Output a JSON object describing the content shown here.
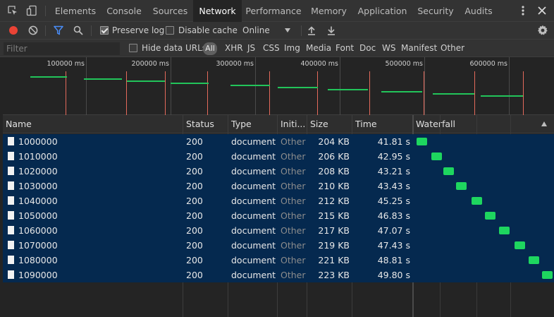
{
  "tabs": [
    {
      "id": "elements",
      "label": "Elements",
      "active": false
    },
    {
      "id": "console",
      "label": "Console",
      "active": false
    },
    {
      "id": "sources",
      "label": "Sources",
      "active": false
    },
    {
      "id": "network",
      "label": "Network",
      "active": true
    },
    {
      "id": "performance",
      "label": "Performance",
      "active": false
    },
    {
      "id": "memory",
      "label": "Memory",
      "active": false
    },
    {
      "id": "application",
      "label": "Application",
      "active": false
    },
    {
      "id": "security",
      "label": "Security",
      "active": false
    },
    {
      "id": "audits",
      "label": "Audits",
      "active": false
    }
  ],
  "toolbar": {
    "preserve_log_label": "Preserve log",
    "preserve_log_checked": true,
    "disable_cache_label": "Disable cache",
    "disable_cache_checked": false,
    "throttling_value": "Online"
  },
  "filterbar": {
    "filter_placeholder": "Filter",
    "hide_data_urls_label": "Hide data URLs",
    "hide_data_urls_checked": false,
    "types": [
      "All",
      "XHR",
      "JS",
      "CSS",
      "Img",
      "Media",
      "Font",
      "Doc",
      "WS",
      "Manifest",
      "Other"
    ],
    "active_type": "All"
  },
  "overview": {
    "ticks": [
      "100000 ms",
      "200000 ms",
      "300000 ms",
      "400000 ms",
      "500000 ms",
      "600000 ms"
    ]
  },
  "table": {
    "headers": {
      "name": "Name",
      "status": "Status",
      "type": "Type",
      "initiator": "Initi...",
      "size": "Size",
      "time": "Time",
      "waterfall": "Waterfall"
    },
    "rows": [
      {
        "name": "1000000",
        "status": "200",
        "type": "document",
        "initiator": "Other",
        "size": "204 KB",
        "time": "41.81 s"
      },
      {
        "name": "1010000",
        "status": "200",
        "type": "document",
        "initiator": "Other",
        "size": "206 KB",
        "time": "42.95 s"
      },
      {
        "name": "1020000",
        "status": "200",
        "type": "document",
        "initiator": "Other",
        "size": "208 KB",
        "time": "43.21 s"
      },
      {
        "name": "1030000",
        "status": "200",
        "type": "document",
        "initiator": "Other",
        "size": "210 KB",
        "time": "43.43 s"
      },
      {
        "name": "1040000",
        "status": "200",
        "type": "document",
        "initiator": "Other",
        "size": "212 KB",
        "time": "45.25 s"
      },
      {
        "name": "1050000",
        "status": "200",
        "type": "document",
        "initiator": "Other",
        "size": "215 KB",
        "time": "46.83 s"
      },
      {
        "name": "1060000",
        "status": "200",
        "type": "document",
        "initiator": "Other",
        "size": "217 KB",
        "time": "47.07 s"
      },
      {
        "name": "1070000",
        "status": "200",
        "type": "document",
        "initiator": "Other",
        "size": "219 KB",
        "time": "47.43 s"
      },
      {
        "name": "1080000",
        "status": "200",
        "type": "document",
        "initiator": "Other",
        "size": "221 KB",
        "time": "48.81 s"
      },
      {
        "name": "1090000",
        "status": "200",
        "type": "document",
        "initiator": "Other",
        "size": "223 KB",
        "time": "49.80 s"
      }
    ]
  },
  "colors": {
    "record": "#ea4335",
    "filter_active": "#4a8df8",
    "waterfall_bar": "#1ed65f",
    "row_selected_bg": "#05294f"
  }
}
